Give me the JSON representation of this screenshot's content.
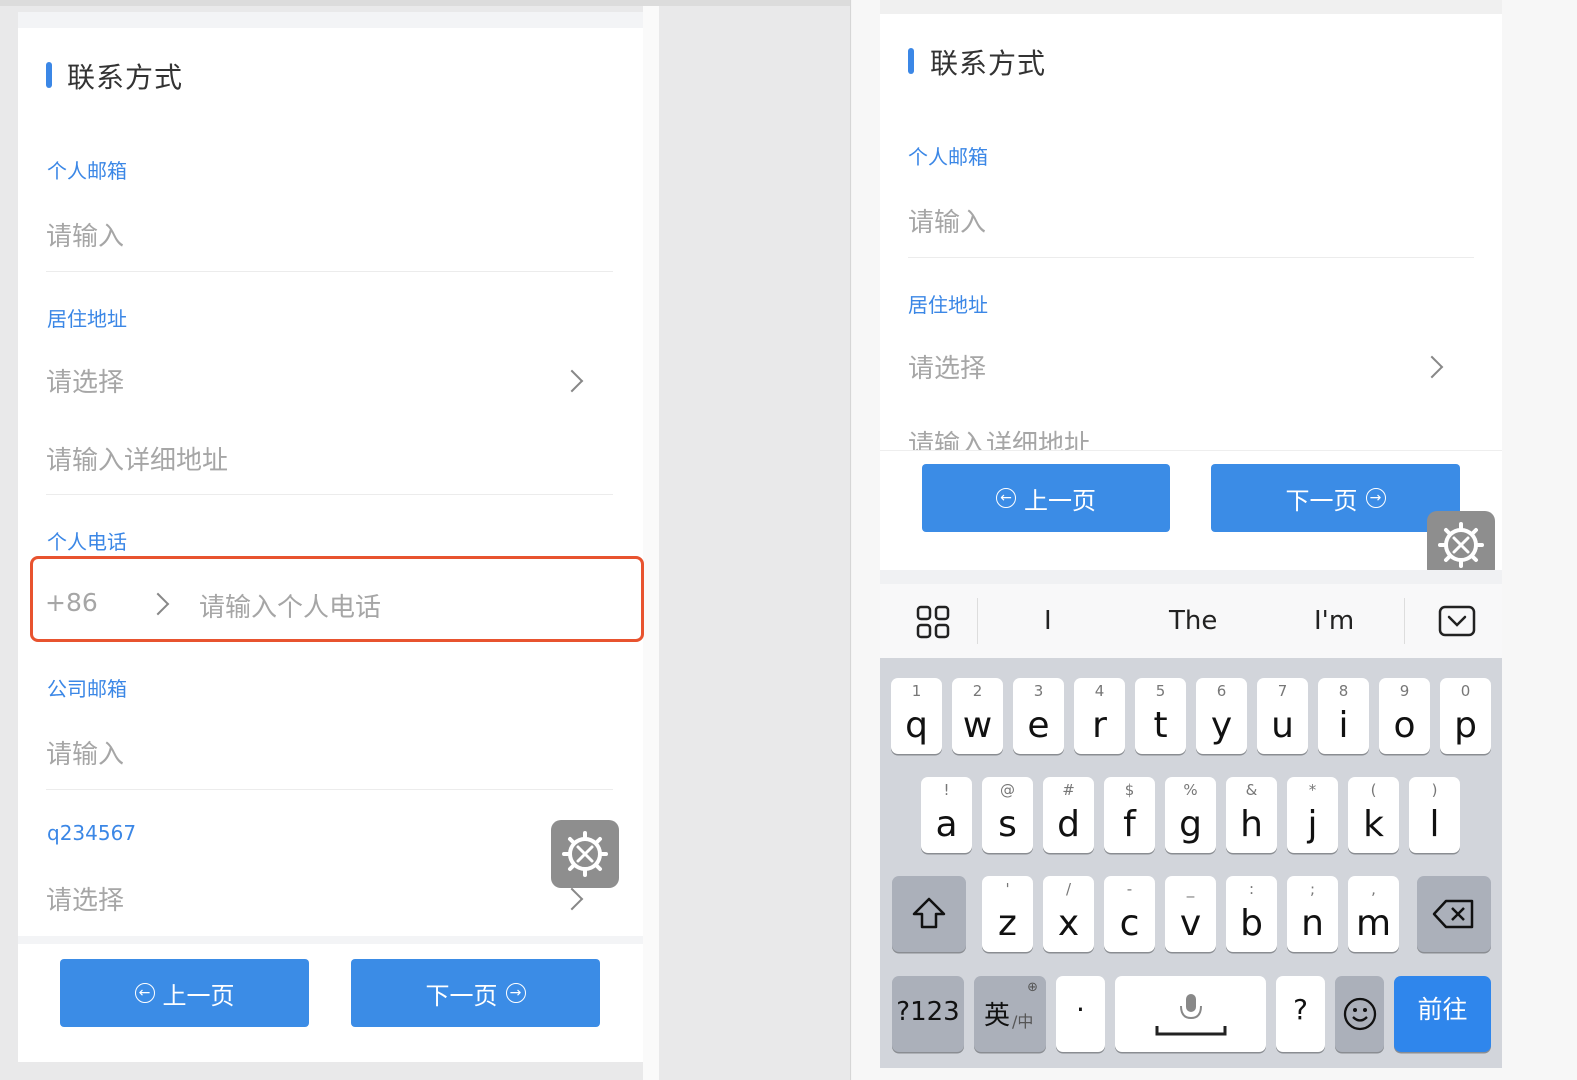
{
  "left": {
    "section_title": "联系方式",
    "email_label": "个人邮箱",
    "email_placeholder": "请输入",
    "address_label": "居住地址",
    "address_select_placeholder": "请选择",
    "address_detail_placeholder": "请输入详细地址",
    "phone_label": "个人电话",
    "phone_code": "+86",
    "phone_placeholder": "请输入个人电话",
    "company_email_label": "公司邮箱",
    "company_email_placeholder": "请输入",
    "custom_label": "q234567",
    "custom_placeholder": "请选择",
    "prev_label": "上一页",
    "next_label": "下一页"
  },
  "right": {
    "section_title": "联系方式",
    "email_label": "个人邮箱",
    "email_placeholder": "请输入",
    "address_label": "居住地址",
    "address_select_placeholder": "请选择",
    "address_detail_placeholder": "请输入详细地址",
    "prev_label": "上一页",
    "next_label": "下一页"
  },
  "keyboard": {
    "suggestions": [
      "I",
      "The",
      "I'm"
    ],
    "row1": [
      {
        "sub": "1",
        "main": "q"
      },
      {
        "sub": "2",
        "main": "w"
      },
      {
        "sub": "3",
        "main": "e"
      },
      {
        "sub": "4",
        "main": "r"
      },
      {
        "sub": "5",
        "main": "t"
      },
      {
        "sub": "6",
        "main": "y"
      },
      {
        "sub": "7",
        "main": "u"
      },
      {
        "sub": "8",
        "main": "i"
      },
      {
        "sub": "9",
        "main": "o"
      },
      {
        "sub": "0",
        "main": "p"
      }
    ],
    "row2": [
      {
        "sub": "!",
        "main": "a"
      },
      {
        "sub": "@",
        "main": "s"
      },
      {
        "sub": "#",
        "main": "d"
      },
      {
        "sub": "$",
        "main": "f"
      },
      {
        "sub": "%",
        "main": "g"
      },
      {
        "sub": "&",
        "main": "h"
      },
      {
        "sub": "*",
        "main": "j"
      },
      {
        "sub": "(",
        "main": "k"
      },
      {
        "sub": ")",
        "main": "l"
      }
    ],
    "row3": [
      {
        "sub": "'",
        "main": "z"
      },
      {
        "sub": "/",
        "main": "x"
      },
      {
        "sub": "-",
        "main": "c"
      },
      {
        "sub": "_",
        "main": "v"
      },
      {
        "sub": ":",
        "main": "b"
      },
      {
        "sub": ";",
        "main": "n"
      },
      {
        "sub": ",",
        "main": "m"
      }
    ],
    "numbers_key": "?123",
    "lang_key": "英",
    "lang_key_alt": "/中",
    "dot_key": "·",
    "question_key": "?",
    "go_key": "前往"
  },
  "colors": {
    "accent": "#3b87e6",
    "highlight": "#e8532f",
    "button": "#3b8ce6"
  }
}
